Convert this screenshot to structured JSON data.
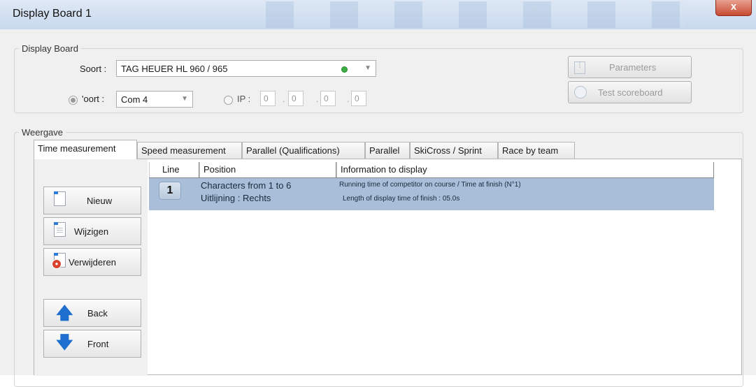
{
  "window": {
    "title": "Display Board 1",
    "close_glyph": "x"
  },
  "display_board": {
    "legend": "Display Board",
    "soort_label": "Soort :",
    "soort_value": "TAG HEUER HL 960 / 965",
    "port_label": "'oort :",
    "port_value": "Com 4",
    "ip_label": "IP :",
    "ip_octets": [
      "0",
      "0",
      "0",
      "0"
    ],
    "parameters_label": "Parameters",
    "test_label": "Test scoreboard",
    "status_color": "#3cb043"
  },
  "weergave": {
    "legend": "Weergave",
    "tabs": [
      "Time measurement",
      "Speed measurement",
      "Parallel (Qualifications)",
      "Parallel",
      "SkiCross / Sprint",
      "Race by team"
    ],
    "active_tab": 0
  },
  "side_buttons": {
    "new": "Nieuw",
    "edit": "Wijzigen",
    "delete": "Verwijderen",
    "back": "Back",
    "front": "Front"
  },
  "grid": {
    "columns": [
      "Line",
      "Position",
      "Information to display"
    ],
    "rows": [
      {
        "line": "1",
        "position_1": "Characters from 1 to 6",
        "position_2": "Uitlijning : Rechts",
        "info_1": "Running time of competitor on course / Time at finish (N°1)",
        "info_2": "Length of display time of finish : 05.0s"
      }
    ],
    "selected_row_color": "#a9bfd9"
  }
}
